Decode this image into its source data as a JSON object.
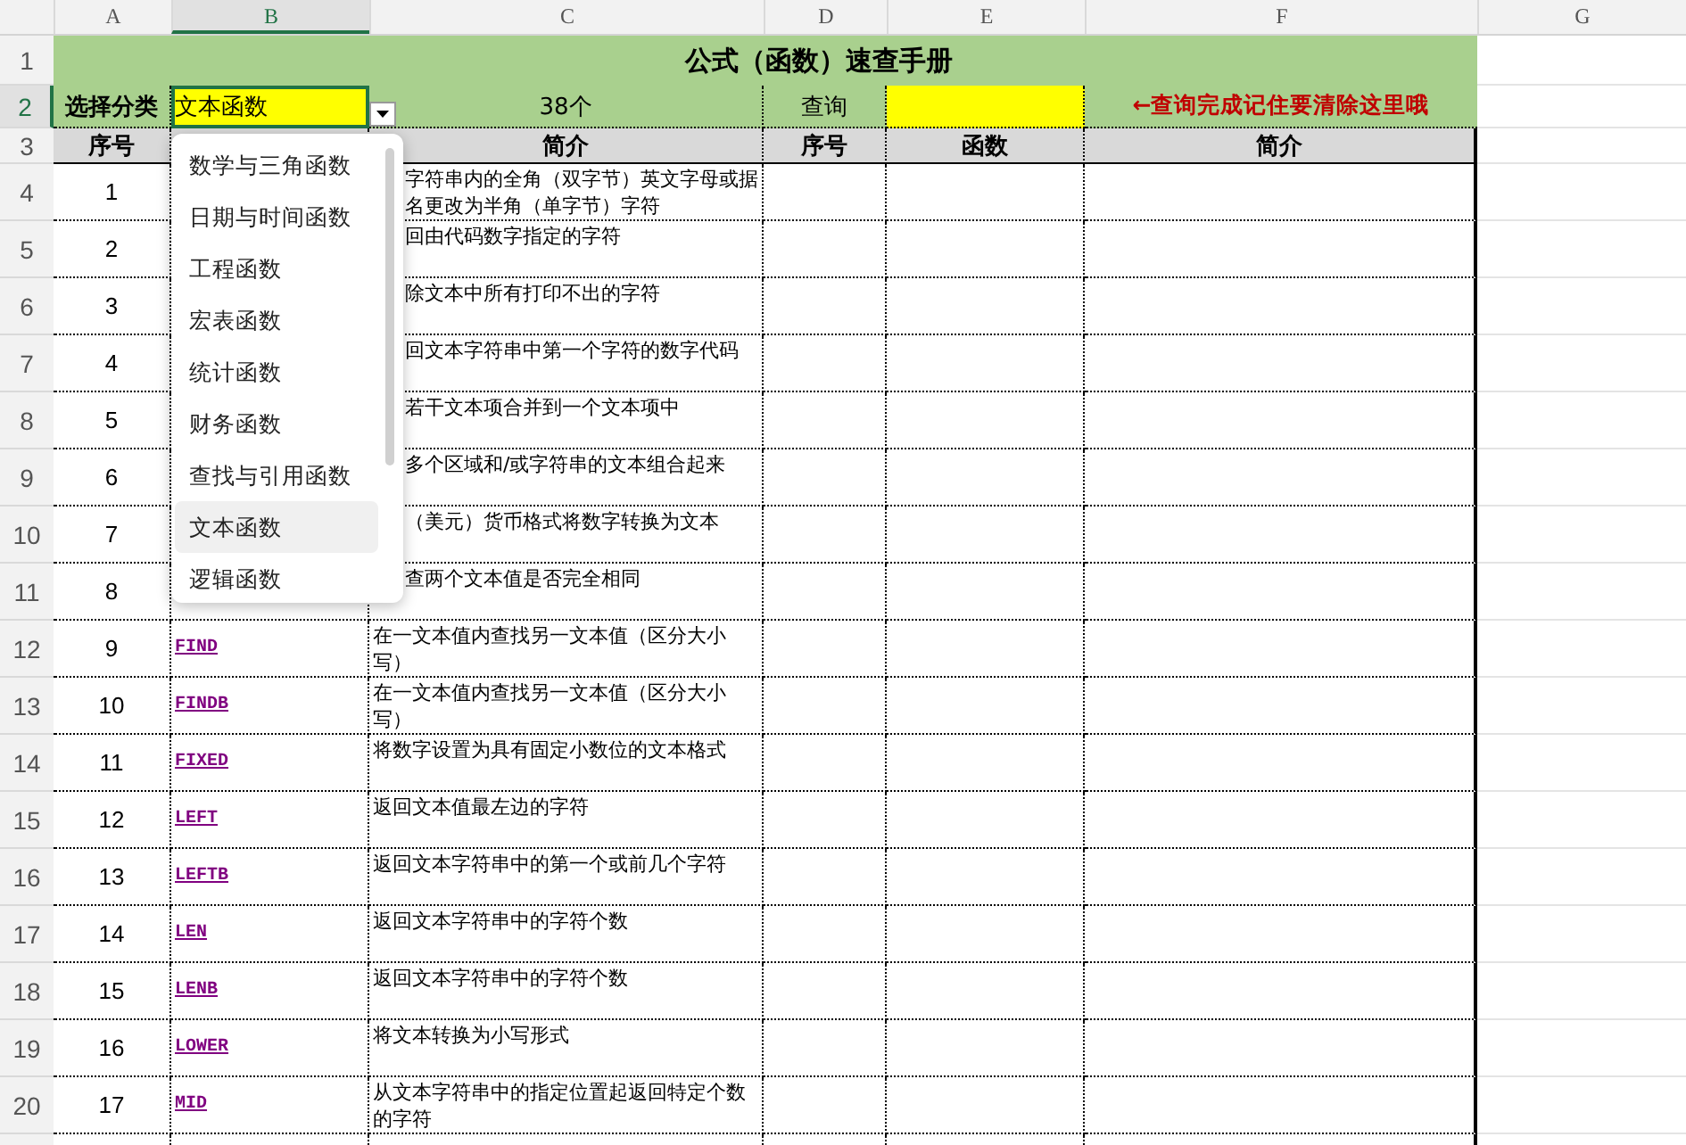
{
  "column_headers": [
    {
      "label": "A",
      "selected": false
    },
    {
      "label": "B",
      "selected": true
    },
    {
      "label": "C",
      "selected": false
    },
    {
      "label": "D",
      "selected": false
    },
    {
      "label": "E",
      "selected": false
    },
    {
      "label": "F",
      "selected": false
    },
    {
      "label": "G",
      "selected": false
    }
  ],
  "row_headers": [
    {
      "label": "1",
      "selected": false
    },
    {
      "label": "2",
      "selected": true
    },
    {
      "label": "3",
      "selected": false
    },
    {
      "label": "4",
      "selected": false
    },
    {
      "label": "5",
      "selected": false
    },
    {
      "label": "6",
      "selected": false
    },
    {
      "label": "7",
      "selected": false
    },
    {
      "label": "8",
      "selected": false
    },
    {
      "label": "9",
      "selected": false
    },
    {
      "label": "10",
      "selected": false
    },
    {
      "label": "11",
      "selected": false
    },
    {
      "label": "12",
      "selected": false
    },
    {
      "label": "13",
      "selected": false
    },
    {
      "label": "14",
      "selected": false
    },
    {
      "label": "15",
      "selected": false
    },
    {
      "label": "16",
      "selected": false
    },
    {
      "label": "17",
      "selected": false
    },
    {
      "label": "18",
      "selected": false
    },
    {
      "label": "19",
      "selected": false
    },
    {
      "label": "20",
      "selected": false
    }
  ],
  "title": "公式（函数）速查手册",
  "filter": {
    "label": "选择分类",
    "value": "文本函数",
    "count": "38个",
    "query_label": "查询",
    "note": "←查询完成记住要清除这里哦"
  },
  "header": {
    "left": [
      "序号",
      "简介"
    ],
    "right": [
      "序号",
      "函数",
      "简介"
    ]
  },
  "rows": [
    {
      "kind": "clipped",
      "no": "1",
      "desc": "字符串内的全角（双字节）英文字母或据名更改为半角（单字节）字符"
    },
    {
      "kind": "clipped",
      "no": "2",
      "desc": "回由代码数字指定的字符"
    },
    {
      "kind": "clipped",
      "no": "3",
      "desc": "除文本中所有打印不出的字符"
    },
    {
      "kind": "clipped",
      "no": "4",
      "desc": "回文本字符串中第一个字符的数字代码"
    },
    {
      "kind": "clipped",
      "no": "5",
      "desc": "若干文本项合并到一个文本项中"
    },
    {
      "kind": "clipped",
      "no": "6",
      "desc": "多个区域和/或字符串的文本组合起来"
    },
    {
      "kind": "clipped",
      "no": "7",
      "desc": "（美元）货币格式将数字转换为文本"
    },
    {
      "kind": "clipped",
      "no": "8",
      "desc": "查两个文本值是否完全相同"
    },
    {
      "kind": "full",
      "no": "9",
      "func": "FIND",
      "desc": "在一文本值内查找另一文本值（区分大小写）"
    },
    {
      "kind": "full",
      "no": "10",
      "func": "FINDB",
      "desc": "在一文本值内查找另一文本值（区分大小写）"
    },
    {
      "kind": "full",
      "no": "11",
      "func": "FIXED",
      "desc": "将数字设置为具有固定小数位的文本格式"
    },
    {
      "kind": "full",
      "no": "12",
      "func": "LEFT",
      "desc": "返回文本值最左边的字符"
    },
    {
      "kind": "full",
      "no": "13",
      "func": "LEFTB",
      "desc": "返回文本字符串中的第一个或前几个字符"
    },
    {
      "kind": "full",
      "no": "14",
      "func": "LEN",
      "desc": "返回文本字符串中的字符个数"
    },
    {
      "kind": "full",
      "no": "15",
      "func": "LENB",
      "desc": "返回文本字符串中的字符个数"
    },
    {
      "kind": "full",
      "no": "16",
      "func": "LOWER",
      "desc": "将文本转换为小写形式"
    },
    {
      "kind": "full",
      "no": "17",
      "func": "MID",
      "desc": "从文本字符串中的指定位置起返回特定个数的字符"
    }
  ],
  "dropdown": [
    {
      "label": "数学与三角函数",
      "selected": false
    },
    {
      "label": "日期与时间函数",
      "selected": false
    },
    {
      "label": "工程函数",
      "selected": false
    },
    {
      "label": "宏表函数",
      "selected": false
    },
    {
      "label": "统计函数",
      "selected": false
    },
    {
      "label": "财务函数",
      "selected": false
    },
    {
      "label": "查找与引用函数",
      "selected": false
    },
    {
      "label": "文本函数",
      "selected": true
    },
    {
      "label": "逻辑函数",
      "selected": false
    }
  ]
}
